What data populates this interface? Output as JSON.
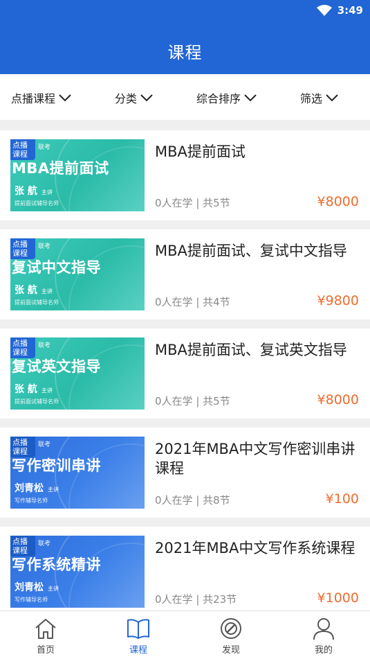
{
  "status": {
    "time": "3:49"
  },
  "header": {
    "title": "课程"
  },
  "filters": [
    {
      "label": "点播课程"
    },
    {
      "label": "分类"
    },
    {
      "label": "综合排序"
    },
    {
      "label": "筛选"
    }
  ],
  "courses": [
    {
      "title": "MBA提前面试",
      "students": "0人在学",
      "sessions": "共5节",
      "price": "¥8000",
      "thumb": {
        "badge": "点播课程",
        "exam": "联考",
        "headline": "MBA提前面试",
        "teacher": "张 航",
        "role": "主讲",
        "tagline": "提前面试辅导名师",
        "color": "green"
      }
    },
    {
      "title": "MBA提前面试、复试中文指导",
      "students": "0人在学",
      "sessions": "共4节",
      "price": "¥9800",
      "thumb": {
        "badge": "点播课程",
        "exam": "联考",
        "headline": "复试中文指导",
        "teacher": "张 航",
        "role": "主讲",
        "tagline": "提前面试辅导名师",
        "color": "green"
      }
    },
    {
      "title": "MBA提前面试、复试英文指导",
      "students": "0人在学",
      "sessions": "共5节",
      "price": "¥8000",
      "thumb": {
        "badge": "点播课程",
        "exam": "联考",
        "headline": "复试英文指导",
        "teacher": "张 航",
        "role": "主讲",
        "tagline": "提前面试辅导名师",
        "color": "green"
      }
    },
    {
      "title": "2021年MBA中文写作密训串讲课程",
      "students": "0人在学",
      "sessions": "共8节",
      "price": "¥100",
      "thumb": {
        "badge": "点播课程",
        "exam": "联考",
        "headline": "写作密训串讲",
        "teacher": "刘青松",
        "role": "主讲",
        "tagline": "写作辅导名师",
        "color": "blue"
      }
    },
    {
      "title": "2021年MBA中文写作系统课程",
      "students": "0人在学",
      "sessions": "共23节",
      "price": "¥1000",
      "thumb": {
        "badge": "点播课程",
        "exam": "联考",
        "headline": "写作系统精讲",
        "teacher": "刘青松",
        "role": "主讲",
        "tagline": "写作辅导名师",
        "color": "blue"
      }
    }
  ],
  "tabbar": [
    {
      "label": "首页",
      "icon": "home-icon"
    },
    {
      "label": "课程",
      "icon": "book-icon",
      "active": true
    },
    {
      "label": "发现",
      "icon": "discover-icon"
    },
    {
      "label": "我的",
      "icon": "user-icon"
    }
  ],
  "colors": {
    "primary": "#2166d4",
    "price": "#ef6c2f"
  }
}
